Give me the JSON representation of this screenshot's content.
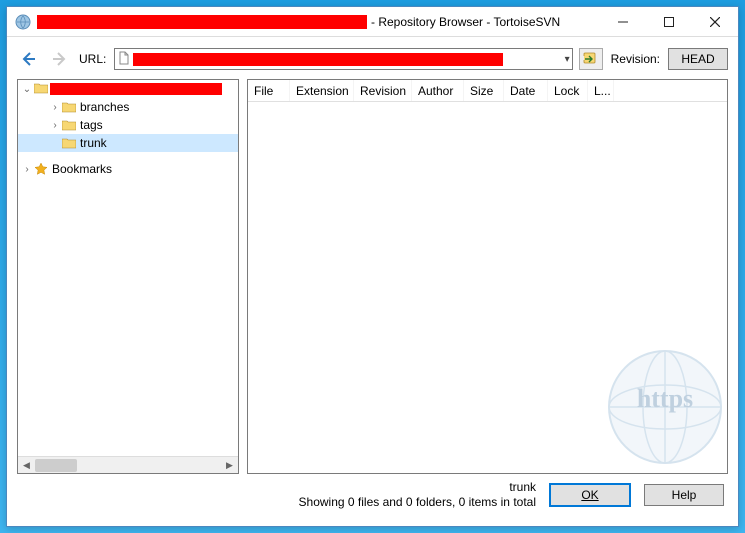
{
  "window": {
    "title_suffix": " - Repository Browser - TortoiseSVN"
  },
  "toolbar": {
    "url_label": "URL:",
    "revision_label": "Revision:",
    "head_button": "HEAD"
  },
  "tree": {
    "root_expanded": true,
    "items": [
      {
        "label": "branches",
        "depth": 2,
        "expandable": true
      },
      {
        "label": "tags",
        "depth": 2,
        "expandable": true
      },
      {
        "label": "trunk",
        "depth": 2,
        "expandable": false,
        "selected": true
      }
    ],
    "bookmarks": {
      "label": "Bookmarks"
    }
  },
  "list": {
    "columns": [
      "File",
      "Extension",
      "Revision",
      "Author",
      "Size",
      "Date",
      "Lock",
      "L..."
    ]
  },
  "footer": {
    "path": "trunk",
    "status": "Showing 0 files and 0 folders, 0 items in total",
    "ok": "OK",
    "help": "Help"
  },
  "watermark": {
    "text": "https"
  }
}
